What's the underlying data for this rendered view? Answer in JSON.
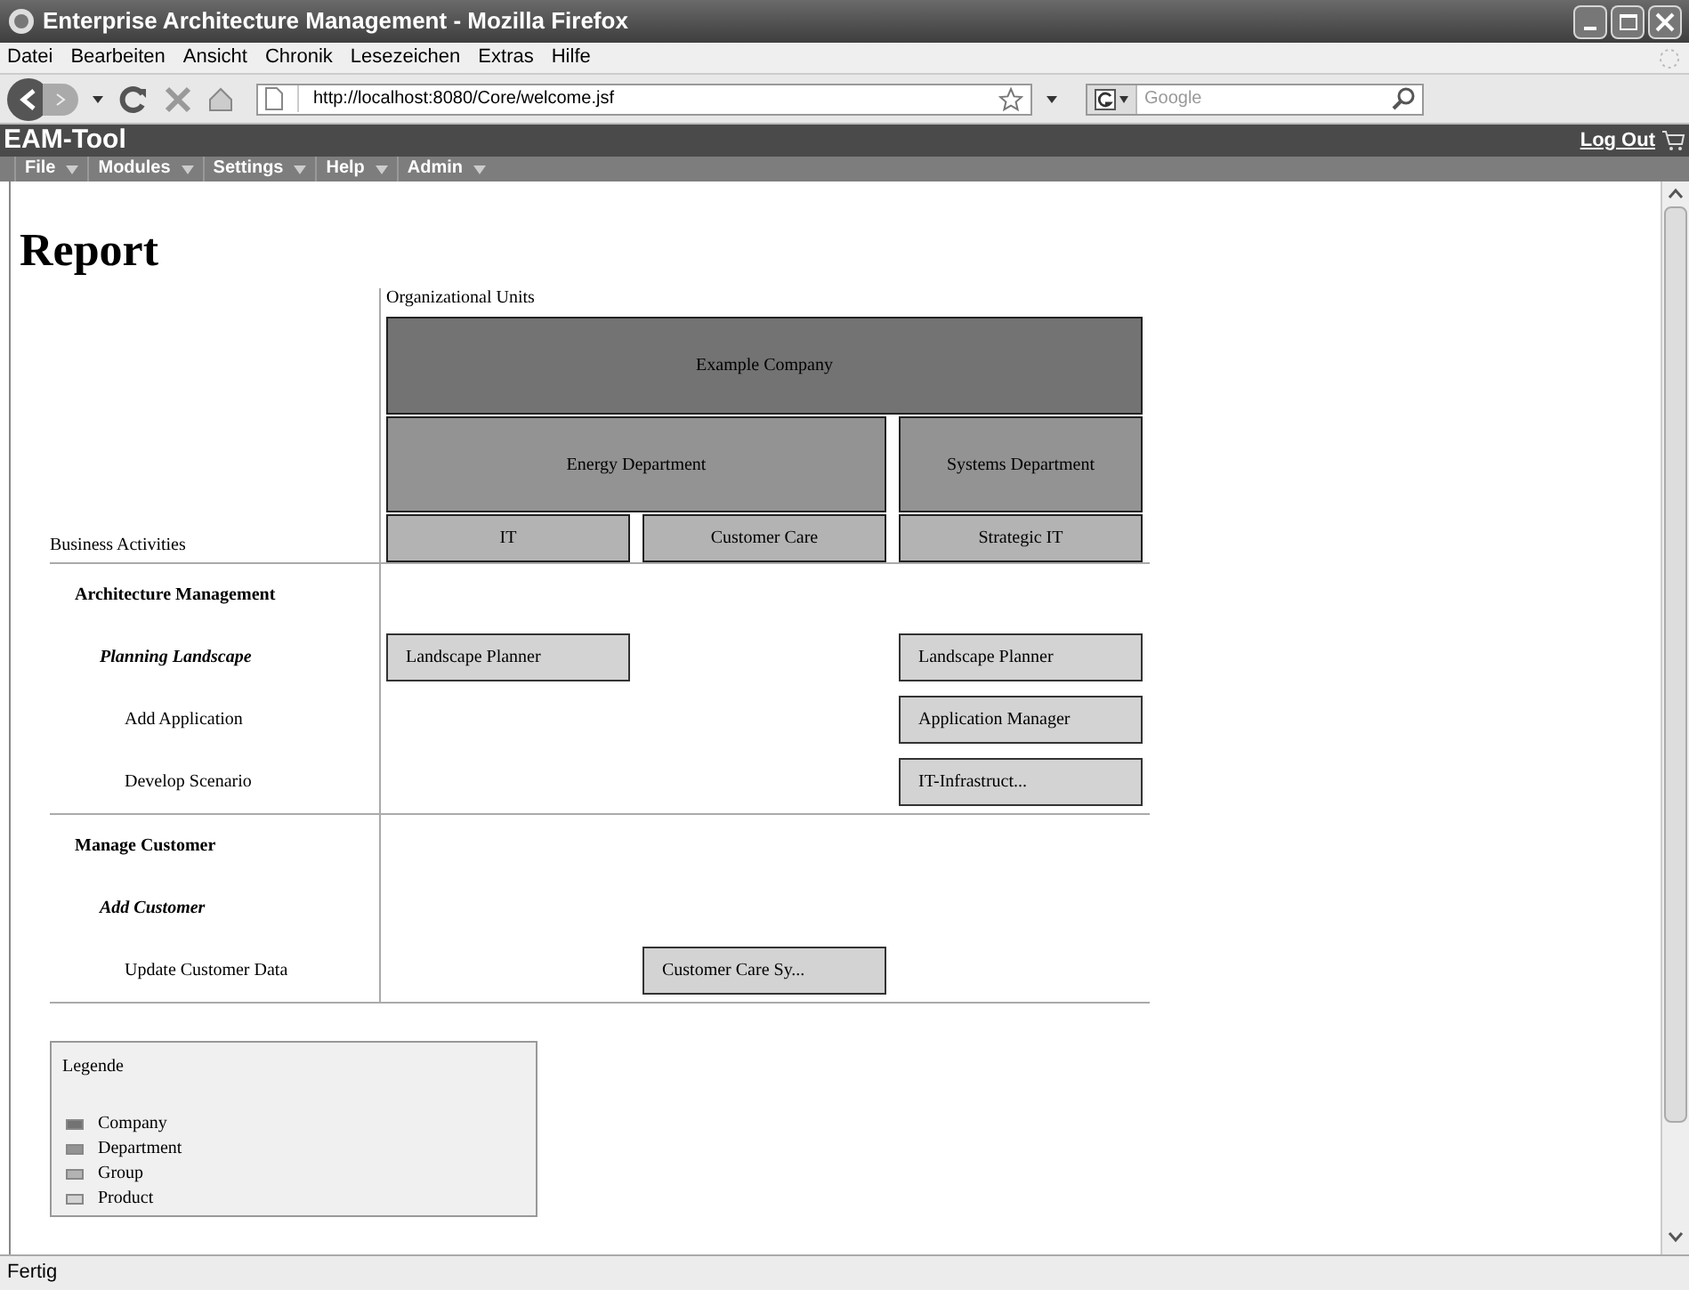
{
  "window": {
    "title": "Enterprise Architecture Management - Mozilla Firefox"
  },
  "browser_menu": [
    "Datei",
    "Bearbeiten",
    "Ansicht",
    "Chronik",
    "Lesezeichen",
    "Extras",
    "Hilfe"
  ],
  "address_bar": {
    "value": "http://localhost:8080/Core/welcome.jsf"
  },
  "search_field": {
    "placeholder": "Google"
  },
  "app": {
    "title": "EAM-Tool",
    "logout": "Log Out",
    "menu": [
      "File",
      "Modules",
      "Settings",
      "Help",
      "Admin"
    ]
  },
  "report": {
    "title": "Report",
    "org_header": "Organizational Units",
    "activities_header": "Business Activities",
    "org_units": {
      "label": "Example Company",
      "kind": "company",
      "children": [
        {
          "label": "Energy Department",
          "kind": "department",
          "children": [
            {
              "label": "IT",
              "kind": "group"
            },
            {
              "label": "Customer Care",
              "kind": "group"
            }
          ]
        },
        {
          "label": "Systems Department",
          "kind": "department",
          "children": [
            {
              "label": "Strategic IT",
              "kind": "group"
            }
          ]
        }
      ]
    },
    "activities": [
      {
        "label": "Architecture Management",
        "children": [
          {
            "label": "Planning Landscape",
            "cells": [
              {
                "label": "Landscape Planner"
              },
              null,
              {
                "label": "Landscape Planner"
              }
            ],
            "children": [
              {
                "label": "Add Application",
                "cells": [
                  null,
                  null,
                  {
                    "label": "Application Manager"
                  }
                ]
              },
              {
                "label": "Develop Scenario",
                "cells": [
                  null,
                  null,
                  {
                    "label": "IT-Infrastruct..."
                  }
                ]
              }
            ]
          }
        ]
      },
      {
        "label": "Manage Customer",
        "children": [
          {
            "label": "Add Customer",
            "children": [
              {
                "label": "Update Customer Data",
                "cells": [
                  null,
                  {
                    "label": "Customer Care Sy..."
                  },
                  null
                ]
              }
            ]
          }
        ]
      }
    ]
  },
  "legend": {
    "title": "Legende",
    "items": [
      {
        "label": "Company",
        "kind": "company"
      },
      {
        "label": "Department",
        "kind": "department"
      },
      {
        "label": "Group",
        "kind": "group"
      },
      {
        "label": "Product",
        "kind": "product"
      }
    ]
  },
  "status_bar": "Fertig"
}
